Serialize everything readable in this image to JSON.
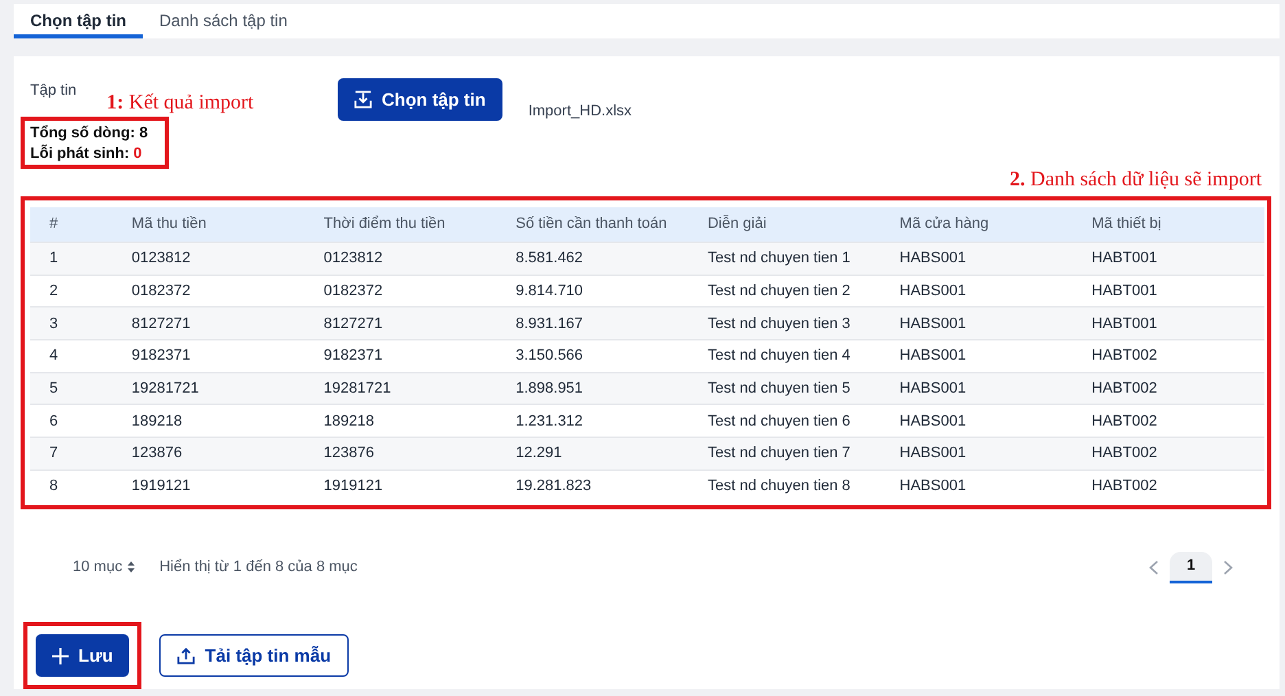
{
  "tabs": [
    {
      "label": "Chọn tập tin",
      "selected": true
    },
    {
      "label": "Danh sách tập tin",
      "selected": false
    }
  ],
  "file_picker": {
    "label": "Tập tin",
    "button": "Chọn tập tin",
    "file_name": "Import_HD.xlsx"
  },
  "annotations": [
    "**1:** Kết quả import",
    "**2.** Danh sách dữ liệu sẽ import"
  ],
  "summary": {
    "total_label": "Tổng số dòng:",
    "total": "8",
    "errors_label": "Lỗi phát sinh:",
    "errors": "0"
  },
  "table": {
    "columns": [
      "#",
      "Mã thu tiền",
      "Thời điểm thu tiền",
      "Số tiền cần thanh toán",
      "Diễn giải",
      "Mã cửa hàng",
      "Mã thiết bị"
    ],
    "rows": [
      [
        "1",
        "0123812",
        "0123812",
        "8.581.462",
        "Test nd chuyen tien 1",
        "HABS001",
        "HABT001"
      ],
      [
        "2",
        "0182372",
        "0182372",
        "9.814.710",
        "Test nd chuyen tien 2",
        "HABS001",
        "HABT001"
      ],
      [
        "3",
        "8127271",
        "8127271",
        "8.931.167",
        "Test nd chuyen tien 3",
        "HABS001",
        "HABT001"
      ],
      [
        "4",
        "9182371",
        "9182371",
        "3.150.566",
        "Test nd chuyen tien 4",
        "HABS001",
        "HABT002"
      ],
      [
        "5",
        "19281721",
        "19281721",
        "1.898.951",
        "Test nd chuyen tien 5",
        "HABS001",
        "HABT002"
      ],
      [
        "6",
        "189218",
        "189218",
        "1.231.312",
        "Test nd chuyen tien 6",
        "HABS001",
        "HABT002"
      ],
      [
        "7",
        "123876",
        "123876",
        "12.291",
        "Test nd chuyen tien 7",
        "HABS001",
        "HABT002"
      ],
      [
        "8",
        "1919121",
        "1919121",
        "19.281.823",
        "Test nd chuyen tien 8",
        "HABS001",
        "HABT002"
      ]
    ]
  },
  "pagination": {
    "page_size": "10 mục",
    "info": "Hiển thị từ 1 đến 8 của 8 mục",
    "pages": [
      {
        "label": "1",
        "selected": true
      }
    ]
  },
  "actions": [
    {
      "kind": "primary",
      "label": "Lưu",
      "highlighted": true
    },
    {
      "kind": "outline",
      "label": "Tải tập tin mẫu",
      "highlighted": false
    }
  ]
}
